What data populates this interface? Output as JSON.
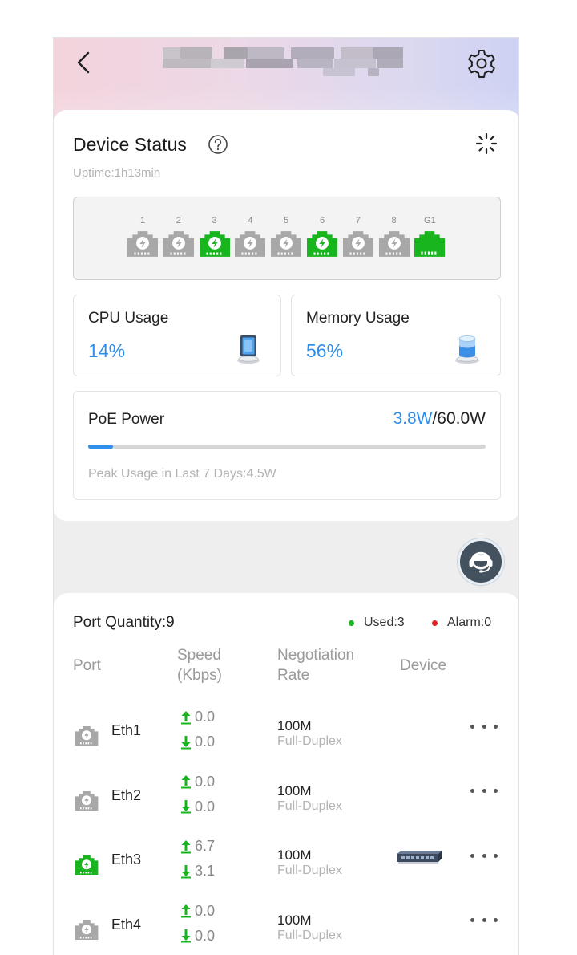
{
  "status": {
    "title": "Device Status",
    "uptime": "Uptime:1h13min"
  },
  "ports_panel": [
    {
      "label": "1",
      "active": false,
      "type": "poe"
    },
    {
      "label": "2",
      "active": false,
      "type": "poe"
    },
    {
      "label": "3",
      "active": true,
      "type": "poe"
    },
    {
      "label": "4",
      "active": false,
      "type": "poe"
    },
    {
      "label": "5",
      "active": false,
      "type": "poe"
    },
    {
      "label": "6",
      "active": true,
      "type": "poe"
    },
    {
      "label": "7",
      "active": false,
      "type": "poe"
    },
    {
      "label": "8",
      "active": false,
      "type": "poe"
    },
    {
      "label": "G1",
      "active": true,
      "type": "gigabit"
    }
  ],
  "cpu": {
    "label": "CPU Usage",
    "value": "14%"
  },
  "memory": {
    "label": "Memory Usage",
    "value": "56%"
  },
  "poe": {
    "label": "PoE Power",
    "used": "3.8W",
    "total": "/60.0W",
    "fraction": 0.063,
    "peak": "Peak Usage in Last 7 Days:4.5W"
  },
  "port_list": {
    "title": "Port Quantity:9",
    "used": "Used:3",
    "alarm": "Alarm:0",
    "headers": {
      "port": "Port",
      "speed_1": "Speed",
      "speed_2": "(Kbps)",
      "rate_1": "Negotiation",
      "rate_2": "Rate",
      "device": "Device"
    },
    "rows": [
      {
        "name": "Eth1",
        "up": "0.0",
        "down": "0.0",
        "rate": "100M",
        "duplex": "Full-Duplex",
        "active": false,
        "device": false
      },
      {
        "name": "Eth2",
        "up": "0.0",
        "down": "0.0",
        "rate": "100M",
        "duplex": "Full-Duplex",
        "active": false,
        "device": false
      },
      {
        "name": "Eth3",
        "up": "6.7",
        "down": "3.1",
        "rate": "100M",
        "duplex": "Full-Duplex",
        "active": true,
        "device": true
      },
      {
        "name": "Eth4",
        "up": "0.0",
        "down": "0.0",
        "rate": "100M",
        "duplex": "Full-Duplex",
        "active": false,
        "device": false
      }
    ]
  },
  "colors": {
    "accent": "#2f8fea",
    "active_port": "#19b51f",
    "inactive_port": "#a8a8a8",
    "used_dot": "#19b51f",
    "alarm_dot": "#e02020"
  },
  "icons": {
    "back": "back-arrow-icon",
    "settings": "gear-icon",
    "help": "help-circle-icon",
    "refresh": "spinner-icon",
    "support": "headset-icon"
  }
}
